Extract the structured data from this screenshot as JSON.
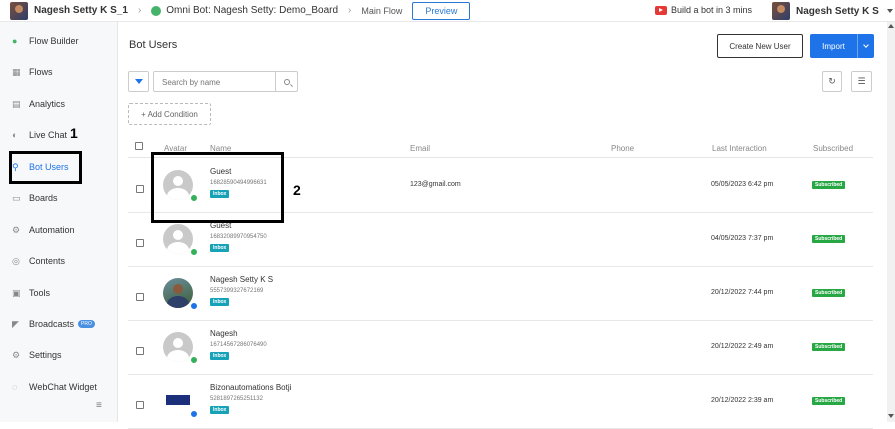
{
  "topbar": {
    "workspace": "Nagesh Setty K S_1",
    "bot": "Omni Bot: Nagesh Setty: Demo_Board",
    "flow": "Main Flow",
    "preview": "Preview",
    "youtube": "Build a bot in 3 mins",
    "user": "Nagesh Setty K S"
  },
  "sidebar": {
    "items": [
      {
        "label": "Flow Builder",
        "icon": "chat-bubbles-icon"
      },
      {
        "label": "Flows",
        "icon": "grid-icon"
      },
      {
        "label": "Analytics",
        "icon": "chart-icon"
      },
      {
        "label": "Live Chat",
        "icon": "headset-icon"
      },
      {
        "label": "Bot Users",
        "icon": "user-icon"
      },
      {
        "label": "Boards",
        "icon": "board-icon"
      },
      {
        "label": "Automation",
        "icon": "gear-icon"
      },
      {
        "label": "Contents",
        "icon": "globe-icon"
      },
      {
        "label": "Tools",
        "icon": "toolbox-icon"
      },
      {
        "label": "Broadcasts",
        "icon": "megaphone-icon",
        "badge": "PRO"
      },
      {
        "label": "Settings",
        "icon": "settings-icon"
      },
      {
        "label": "WebChat Widget",
        "icon": "chat-widget-icon"
      }
    ],
    "active": "Bot Users"
  },
  "main": {
    "title": "Bot Users",
    "create_button": "Create New User",
    "import_button": "Import",
    "search_placeholder": "Search by name",
    "add_condition": "+ Add Condition"
  },
  "table": {
    "headers": {
      "avatar": "Avatar",
      "name": "Name",
      "email": "Email",
      "phone": "Phone",
      "last": "Last Interaction",
      "subscribed": "Subscribed"
    },
    "rows": [
      {
        "name": "Guest",
        "id": "16828590494996631",
        "badge": "Inbox",
        "email": "123@gmail.com",
        "phone": "",
        "last": "05/05/2023 6:42 pm",
        "subscribed": "Subscribed"
      },
      {
        "name": "Guest",
        "id": "16832089970954750",
        "badge": "Inbox",
        "email": "",
        "phone": "",
        "last": "04/05/2023 7:37 pm",
        "subscribed": "Subscribed"
      },
      {
        "name": "Nagesh Setty K S",
        "id": "5557399327672169",
        "badge": "Inbox",
        "email": "",
        "phone": "",
        "last": "20/12/2022 7:44 pm",
        "subscribed": "Subscribed"
      },
      {
        "name": "Nagesh",
        "id": "16714567286076490",
        "badge": "Inbox",
        "email": "",
        "phone": "",
        "last": "20/12/2022 2:49 am",
        "subscribed": "Subscribed"
      },
      {
        "name": "Bizonautomations Botji",
        "id": "5281897265251132",
        "badge": "Inbox",
        "email": "",
        "phone": "",
        "last": "20/12/2022 2:39 am",
        "subscribed": "Subscribed"
      }
    ]
  },
  "annotations": {
    "one": "1",
    "two": "2"
  },
  "colors": {
    "primary": "#1e73e8",
    "subscribed": "#28a745",
    "inbox": "#17a2b8"
  }
}
